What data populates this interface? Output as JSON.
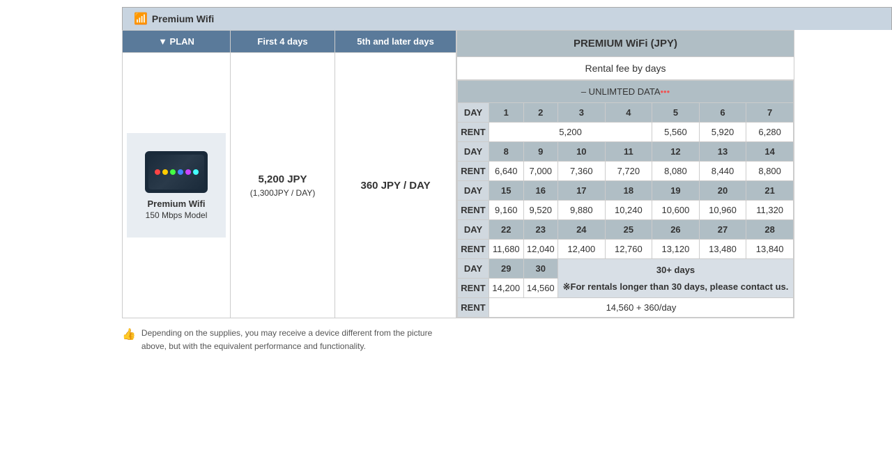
{
  "tab": {
    "label": "Premium Wifi",
    "wifi_icon": "📶"
  },
  "plan_table": {
    "col_plan": "▼ PLAN",
    "col_first": "First 4 days",
    "col_later": "5th and later days",
    "device": {
      "name": "Premium Wifi",
      "model": "150 Mbps Model"
    },
    "first_price_main": "5,200 JPY",
    "first_price_sub": "(1,300JPY / DAY)",
    "later_price": "360 JPY / DAY"
  },
  "notice": {
    "text": "Depending on the supplies, you may receive a device different from the picture above, but with the equivalent performance and functionality."
  },
  "pricing": {
    "title": "PREMIUM WiFi (JPY)",
    "subtitle": "Rental fee by days",
    "unlimited_label": "– UNLIMTED DATA",
    "days_row1": [
      1,
      2,
      3,
      4,
      5,
      6,
      7
    ],
    "rent_row1_merged": "5,200",
    "rent_row1_merged_span": 4,
    "rent_row1_values": [
      "5,560",
      "5,920",
      "6,280"
    ],
    "days_row2": [
      8,
      9,
      10,
      11,
      12,
      13,
      14
    ],
    "rent_row2": [
      "6,640",
      "7,000",
      "7,360",
      "7,720",
      "8,080",
      "8,440",
      "8,800"
    ],
    "days_row3": [
      15,
      16,
      17,
      18,
      19,
      20,
      21
    ],
    "rent_row3": [
      "9,160",
      "9,520",
      "9,880",
      "10,240",
      "10,600",
      "10,960",
      "11,320"
    ],
    "days_row4": [
      22,
      23,
      24,
      25,
      26,
      27,
      28
    ],
    "rent_row4": [
      "11,680",
      "12,040",
      "12,400",
      "12,760",
      "13,120",
      "13,480",
      "13,840"
    ],
    "days_row5": [
      29,
      30
    ],
    "note_30plus": "30+ days",
    "note_contact": "※For rentals longer than 30 days, please contact us.",
    "rent_row5_29": "14,200",
    "rent_row5_30": "14,560",
    "rent_row5_note": "14,560 + 360/day"
  }
}
